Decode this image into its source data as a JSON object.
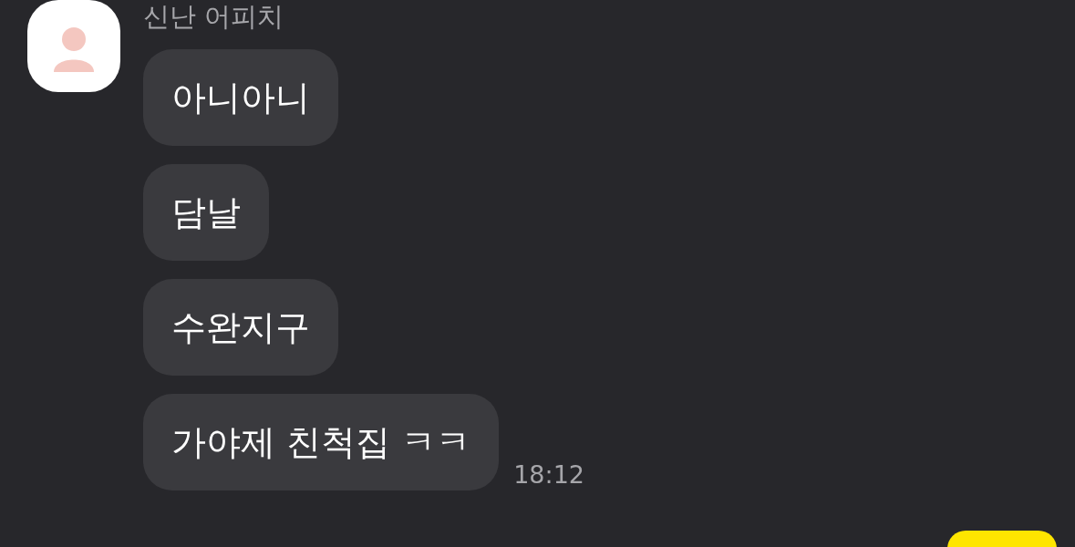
{
  "sender": {
    "name": "신난 어피치"
  },
  "messages": [
    {
      "text": "아니아니"
    },
    {
      "text": "담날"
    },
    {
      "text": "수완지구"
    },
    {
      "text": "가야제 친척집 ㅋㅋ"
    }
  ],
  "time": "18:12"
}
